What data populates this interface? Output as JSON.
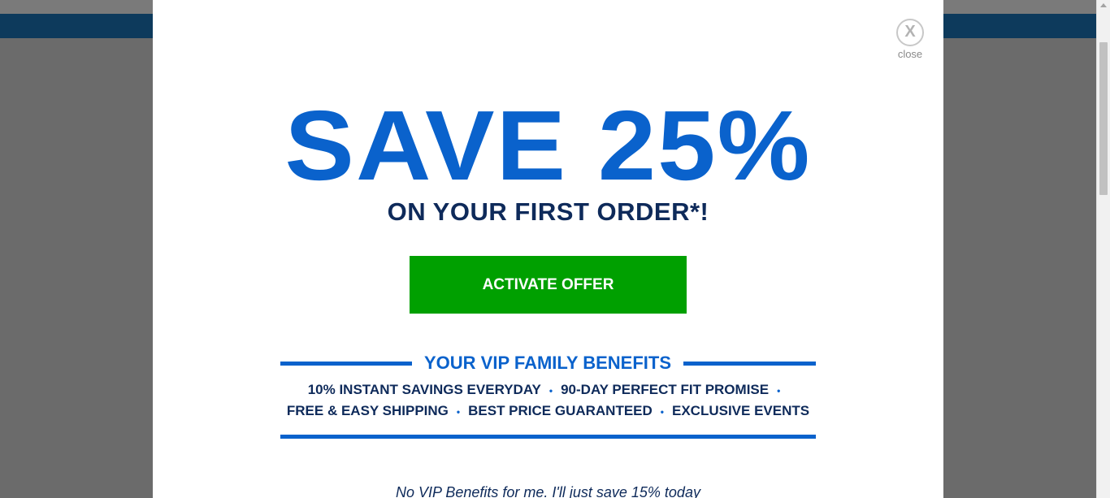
{
  "modal": {
    "close_icon": "X",
    "close_label": "close",
    "headline": "SAVE 25%",
    "subheadline": "ON YOUR FIRST ORDER*!",
    "cta_label": "ACTIVATE OFFER",
    "benefits_title": "YOUR VIP FAMILY BENEFITS",
    "benefits": [
      "10% INSTANT SAVINGS EVERYDAY",
      "90-DAY PERFECT FIT PROMISE",
      "FREE & EASY SHIPPING",
      "BEST PRICE GUARANTEED",
      "EXCLUSIVE EVENTS"
    ],
    "separator": "•",
    "decline_label": "No VIP Benefits for me. I'll just save 15% today"
  },
  "colors": {
    "brand_blue": "#0a62cc",
    "navy": "#0e2a5a",
    "cta_green": "#00a000",
    "overlay": "#6b6b6b",
    "header_bar": "#0d3a5c"
  }
}
